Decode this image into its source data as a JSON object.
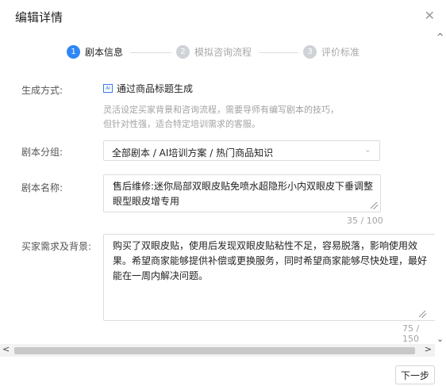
{
  "dialog": {
    "title": "编辑详情",
    "close_glyph": "✕"
  },
  "steps": [
    {
      "number": "1",
      "label": "剧本信息",
      "state": "active"
    },
    {
      "number": "2",
      "label": "模拟咨询流程",
      "state": "inactive"
    },
    {
      "number": "3",
      "label": "评价标准",
      "state": "inactive"
    }
  ],
  "form": {
    "generation": {
      "label": "生成方式:",
      "option_badge": "AI",
      "option_text": "通过商品标题生成"
    },
    "hint_lines": [
      "灵活设定买家背景和咨询流程，需要导师有编写剧本的技巧，",
      "但针对性强，适合特定培训需求的客服。"
    ],
    "category": {
      "label": "剧本分组:",
      "value": "全部剧本 / AI培训方案 / 热门商品知识"
    },
    "name": {
      "label": "剧本名称:",
      "value_lines": [
        "售后维修:迷你局部双眼皮贴免喷水超隐形小内双眼皮下垂调整",
        "眼型眼皮增专用"
      ],
      "counter": "35 / 100"
    },
    "background": {
      "label": "买家需求及背景:",
      "value_lines": [
        "购买了双眼皮贴，使用后发现双眼皮贴粘性不足，容易脱落，影响使用效",
        "果。希望商家能够提供补偿或更换服务，同时希望商家能够尽快处理，最好",
        "能在一周内解决问题。"
      ],
      "counter": "75 / 150"
    }
  },
  "footer": {
    "next_label": "下一步"
  },
  "colors": {
    "accent": "#2f86f6",
    "inactive_step": "#cfd3d8",
    "hint_text": "#a3a3a3"
  }
}
